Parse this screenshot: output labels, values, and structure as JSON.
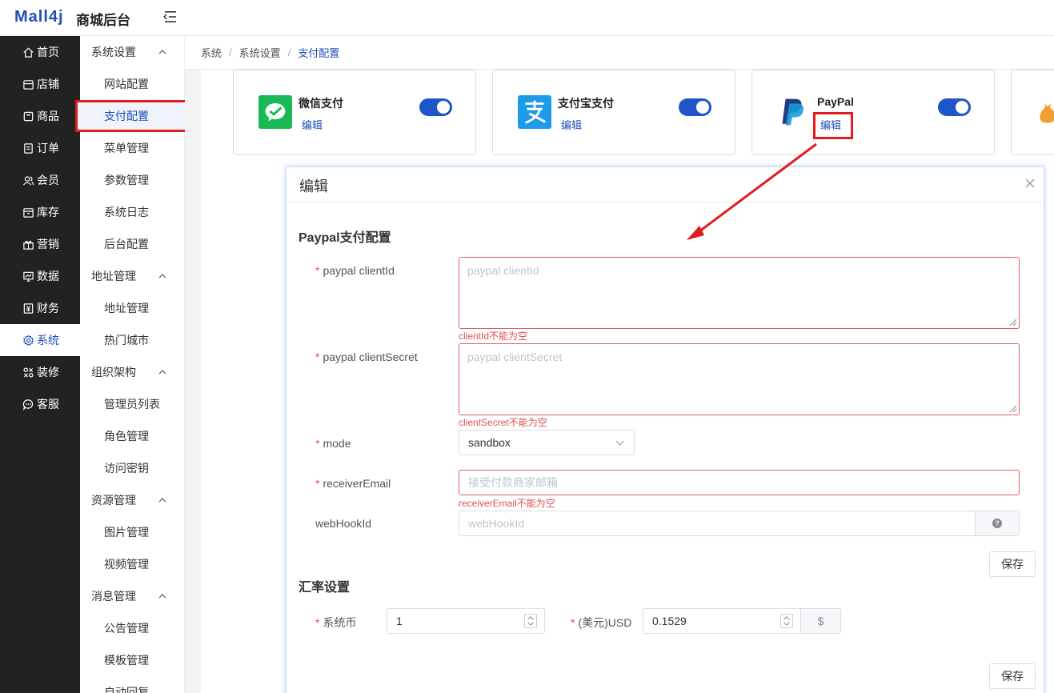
{
  "header": {
    "logo": "Mall4j",
    "app_title": "商城后台"
  },
  "primary_nav": [
    {
      "label": "首页",
      "icon": "home-icon"
    },
    {
      "label": "店铺",
      "icon": "store-icon"
    },
    {
      "label": "商品",
      "icon": "product-icon"
    },
    {
      "label": "订单",
      "icon": "order-icon"
    },
    {
      "label": "会员",
      "icon": "member-icon"
    },
    {
      "label": "库存",
      "icon": "inventory-icon"
    },
    {
      "label": "营销",
      "icon": "gift-icon"
    },
    {
      "label": "数据",
      "icon": "chart-icon"
    },
    {
      "label": "财务",
      "icon": "finance-icon"
    },
    {
      "label": "系统",
      "icon": "gear-icon",
      "active": true
    },
    {
      "label": "装修",
      "icon": "decor-icon"
    },
    {
      "label": "客服",
      "icon": "chat-icon"
    }
  ],
  "secondary_nav": {
    "groups": [
      {
        "title": "系统设置",
        "items": [
          "网站配置",
          "支付配置",
          "菜单管理",
          "参数管理",
          "系统日志",
          "后台配置"
        ]
      },
      {
        "title": "地址管理",
        "items": [
          "地址管理",
          "热门城市"
        ]
      },
      {
        "title": "组织架构",
        "items": [
          "管理员列表",
          "角色管理",
          "访问密钥"
        ]
      },
      {
        "title": "资源管理",
        "items": [
          "图片管理",
          "视频管理"
        ]
      },
      {
        "title": "消息管理",
        "items": [
          "公告管理",
          "模板管理",
          "自动回复"
        ]
      }
    ],
    "active_item": "支付配置"
  },
  "breadcrumb": [
    "系统",
    "系统设置",
    "支付配置"
  ],
  "payment_cards": [
    {
      "name": "微信支付",
      "edit": "编辑",
      "enabled": true,
      "icon": "wechat-pay-icon"
    },
    {
      "name": "支付宝支付",
      "edit": "编辑",
      "enabled": true,
      "icon": "alipay-icon"
    },
    {
      "name": "PayPal",
      "edit": "编辑",
      "enabled": true,
      "icon": "paypal-icon"
    }
  ],
  "dialog": {
    "title": "编辑",
    "paypal_section": "Paypal支付配置",
    "fields": {
      "client_id": {
        "label": "paypal clientId",
        "placeholder": "paypal clientId",
        "error": "clientId不能为空"
      },
      "client_secret": {
        "label": "paypal clientSecret",
        "placeholder": "paypal clientSecret",
        "error": "clientSecret不能为空"
      },
      "mode": {
        "label": "mode",
        "value": "sandbox"
      },
      "receiver_email": {
        "label": "receiverEmail",
        "placeholder": "接受付款商家邮箱",
        "error": "receiverEmail不能为空"
      },
      "webhook_id": {
        "label": "webHookId",
        "placeholder": "webHookId"
      }
    },
    "save_label": "保存",
    "rate_section": "汇率设置",
    "rate": {
      "system_label": "系统币",
      "system_value": "1",
      "usd_label": "(美元)USD",
      "usd_value": "0.1529",
      "usd_unit": "$"
    },
    "save_label_2": "保存"
  },
  "colors": {
    "accent": "#1e4fb8",
    "highlight": "#e01c1c",
    "sidebar_bg": "#222222",
    "error": "#e05050"
  }
}
